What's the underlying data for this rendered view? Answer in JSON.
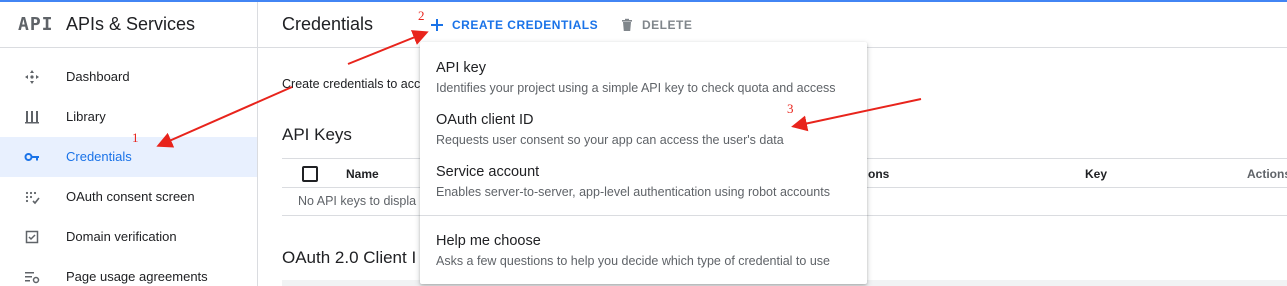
{
  "sidebar": {
    "logo": "API",
    "title": "APIs & Services",
    "items": [
      {
        "label": "Dashboard",
        "icon": "dashboard-icon"
      },
      {
        "label": "Library",
        "icon": "library-icon"
      },
      {
        "label": "Credentials",
        "icon": "key-icon",
        "active": true
      },
      {
        "label": "OAuth consent screen",
        "icon": "consent-icon"
      },
      {
        "label": "Domain verification",
        "icon": "checkbox-icon"
      },
      {
        "label": "Page usage agreements",
        "icon": "settings-list-icon"
      }
    ]
  },
  "header": {
    "title": "Credentials",
    "create_label": "CREATE CREDENTIALS",
    "delete_label": "DELETE"
  },
  "main": {
    "intro": "Create credentials to acc",
    "api_keys_heading": "API Keys",
    "table": {
      "columns": [
        "Name",
        "ons",
        "Key",
        "Actions"
      ],
      "empty_text": "No API keys to displa"
    },
    "oauth_heading": "OAuth 2.0 Client I"
  },
  "dropdown": {
    "items": [
      {
        "title": "API key",
        "description": "Identifies your project using a simple API key to check quota and access"
      },
      {
        "title": "OAuth client ID",
        "description": "Requests user consent so your app can access the user's data"
      },
      {
        "title": "Service account",
        "description": "Enables server-to-server, app-level authentication using robot accounts"
      },
      {
        "title": "Help me choose",
        "description": "Asks a few questions to help you decide which type of credential to use"
      }
    ]
  },
  "annotations": {
    "labels": [
      "1",
      "2",
      "3"
    ],
    "color": "#e8241c"
  },
  "colors": {
    "accent": "#1a73e8",
    "active_bg": "#e8f0fe",
    "border": "#dadce0"
  }
}
